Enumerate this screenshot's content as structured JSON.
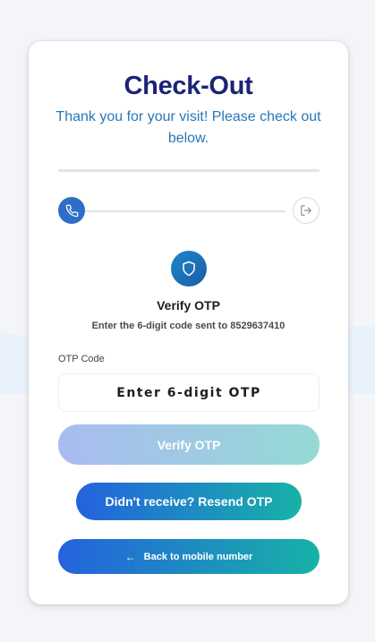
{
  "header": {
    "title": "Check-Out",
    "subtitle": "Thank you for your visit! Please check out below."
  },
  "steps": [
    {
      "icon": "phone-icon",
      "status": "active"
    },
    {
      "icon": "logout-icon",
      "status": "pending"
    }
  ],
  "otp": {
    "icon": "shield-icon",
    "heading": "Verify OTP",
    "instruction": "Enter the 6-digit code sent to 8529637410",
    "field_label": "OTP Code",
    "placeholder": "Enter 6-digit OTP",
    "value": ""
  },
  "buttons": {
    "verify_label": "Verify OTP",
    "resend_label": "Didn't receive? Resend OTP",
    "back_label": "Back to mobile number",
    "back_icon": "arrow-left-icon"
  },
  "colors": {
    "title": "#1b2476",
    "subtitle": "#2a76b4",
    "gradient_start": "#2462de",
    "gradient_end": "#17b2a6",
    "active_step": "#2d6fc6"
  }
}
